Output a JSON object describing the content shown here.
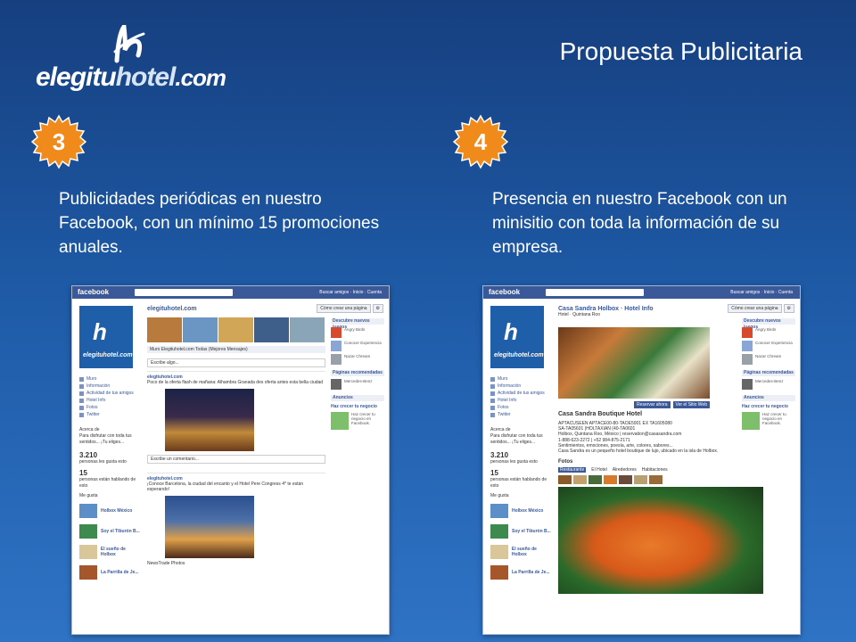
{
  "header": {
    "logo_text_1": "elegitu",
    "logo_text_2": "hotel",
    "logo_text_3": ".com",
    "title": "Propuesta Publicitaria"
  },
  "items": [
    {
      "number": "3",
      "description": "Publicidades periódicas en nuestro Facebook, con un mínimo 15 promociones anuales."
    },
    {
      "number": "4",
      "description": "Presencia en nuestro Facebook con un minisitio con toda la información de su empresa."
    }
  ],
  "screenshots": {
    "left": {
      "app": "facebook",
      "page_name": "elegituhotel.com",
      "page_name_short": "elegituhotel.com",
      "like_button": "Me gusta",
      "create_page": "Cómo crear una página",
      "menu": [
        "Muro",
        "Información",
        "Actividad de tus amigos",
        "Hotel Info",
        "Fotos",
        "Twitter"
      ],
      "about": "Acerca de",
      "count_likes": "3.210",
      "count_likes_label": "personas les gusta esto",
      "count_talking": "15",
      "count_talking_label": "personas están hablando de esto",
      "me_gusta": "Me gusta",
      "side_pages": [
        "Holbox México",
        "Soy el Tiburón B...",
        "El sueño de Holbox",
        "La Parrilla de Je..."
      ],
      "tabs": "Muro    Elegituhotel.com    Todas (Mejores Mensajes)",
      "compose": "Escribe algo...",
      "post1_author": "elegituhotel.com",
      "post1_text": "Poco de la oferta flash de mañana: Alhambra Granada des oferta antes esta bella ciudad",
      "post2_author": "elegituhotel.com",
      "post2_text": "¡Conoce Barcelona, la ciudad del encanto y el Hotel Pere Congress 4* te están esperando!",
      "post2_caption": "NewsTrade Photos",
      "comment_placeholder": "Escribe un comentario...",
      "right_head1": "Descubre nuevos juegos",
      "right_items1": [
        "Angry Birds",
        "Conocer Experiencia",
        "Nazar Chream"
      ],
      "right_head2": "Páginas recomendadas",
      "right_items2": [
        "Mercedes-Benz"
      ],
      "ads_head": "Anuncios",
      "ads_link": "Crear un anuncio",
      "ad_title": "Haz crecer tu negocio"
    },
    "right": {
      "app": "facebook",
      "page_name": "Casa Sandra Holbox · Hotel Info",
      "subtitle": "Hotel · Quintana Roo",
      "hotel_name": "Casa Sandra Boutique Hotel",
      "info_lines": [
        "APTACUSEEN APTACE00-80-TAOE5001 EX TA1605080",
        "SA-TA05601 (HOLTAXIAN (40-TA0601",
        "Holbox, Quintana Roo, México | reservation@casasandra.com",
        "1-888-623-2272 | +52 984-875-2171",
        "Sentimientos, emociones, poesía, arte, colores, sabores...",
        "Casa Sandra es un pequeño hotel boutique de lujo, ubicado en la isla de Holbox."
      ],
      "photos": "Fotos",
      "photo_tabs": [
        "Restaurante",
        "El Hotel",
        "Alrededores",
        "Habitaciones"
      ],
      "reserve_button": "Reservar ahora",
      "web_button": "Ver el Sitio Web"
    }
  },
  "colors": {
    "bg_top": "#163f7f",
    "bg_bottom": "#2f73c5",
    "badge": "#f08a1a",
    "facebook": "#3b5998"
  }
}
